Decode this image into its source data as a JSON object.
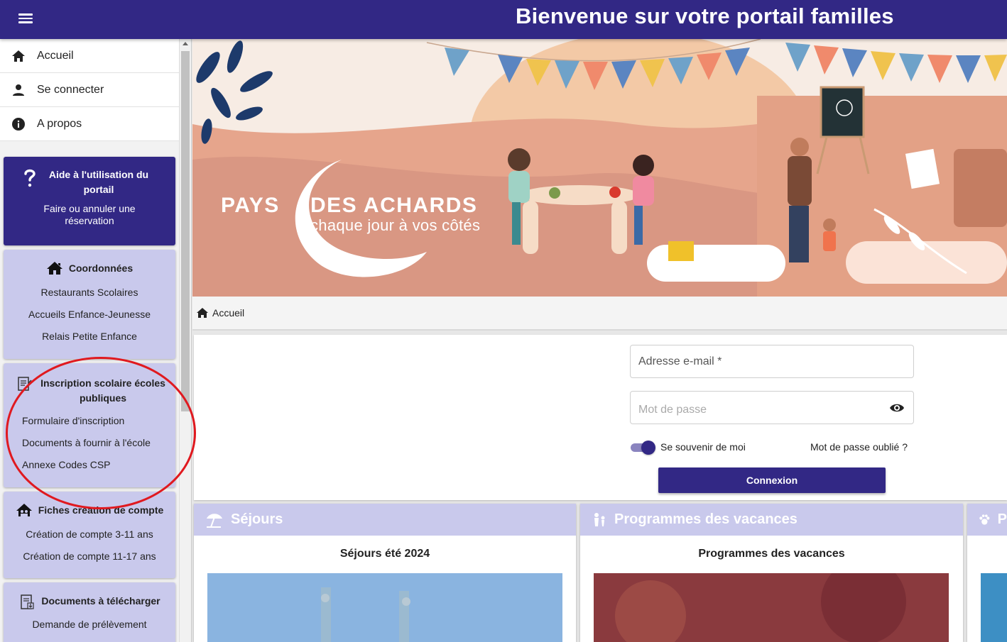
{
  "header": {
    "menu_icon": "hamburger-icon",
    "title": "Bienvenue sur votre portail familles",
    "color": "#322885"
  },
  "sidebar": {
    "menu": [
      {
        "label": "Accueil",
        "icon": "home-icon"
      },
      {
        "label": "Se connecter",
        "icon": "person-icon"
      },
      {
        "label": "A propos",
        "icon": "info-icon"
      }
    ],
    "help_card": {
      "title": "Aide à l'utilisation du portail",
      "subtitle": "Faire ou annuler une réservation",
      "icon": "question-icon"
    },
    "coordonnees": {
      "title": "Coordonnées",
      "icon": "house-icon",
      "links": [
        "Restaurants Scolaires",
        "Accueils Enfance-Jeunesse",
        "Relais Petite Enfance"
      ]
    },
    "inscription": {
      "title": "Inscription scolaire écoles publiques",
      "icon": "document-icon",
      "links": [
        "Formulaire d'inscription",
        "Documents à fournir à l'école",
        "Annexe Codes CSP"
      ]
    },
    "fiches": {
      "title": "Fiches création de compte",
      "icon": "family-house-icon",
      "links": [
        "Création de compte 3-11 ans",
        "Création de compte 11-17 ans"
      ]
    },
    "documents": {
      "title": "Documents à télécharger",
      "icon": "download-document-icon",
      "links": [
        "Demande de prélèvement"
      ]
    }
  },
  "banner": {
    "brand_left": "PAYS",
    "brand_right": "DES ACHARDS",
    "tagline": "chaque jour à vos côtés"
  },
  "breadcrumb": {
    "icon": "home-icon",
    "label": "Accueil"
  },
  "login": {
    "email_placeholder": "Adresse e-mail *",
    "password_placeholder": "Mot de passe",
    "remember_label": "Se souvenir de moi",
    "remember_checked": true,
    "forgot_label": "Mot de passe oublié ?",
    "submit_label": "Connexion"
  },
  "tiles": [
    {
      "title": "Séjours",
      "subtitle": "Séjours été 2024",
      "icon": "beach-umbrella-icon"
    },
    {
      "title": "Programmes des vacances",
      "subtitle": "Programmes des vacances",
      "icon": "kids-activity-icon"
    },
    {
      "title": "P",
      "subtitle": "",
      "icon": "paw-icon"
    }
  ],
  "colors": {
    "primary": "#322885",
    "card_light": "#c9c9ec",
    "annotation": "#e0191f"
  }
}
